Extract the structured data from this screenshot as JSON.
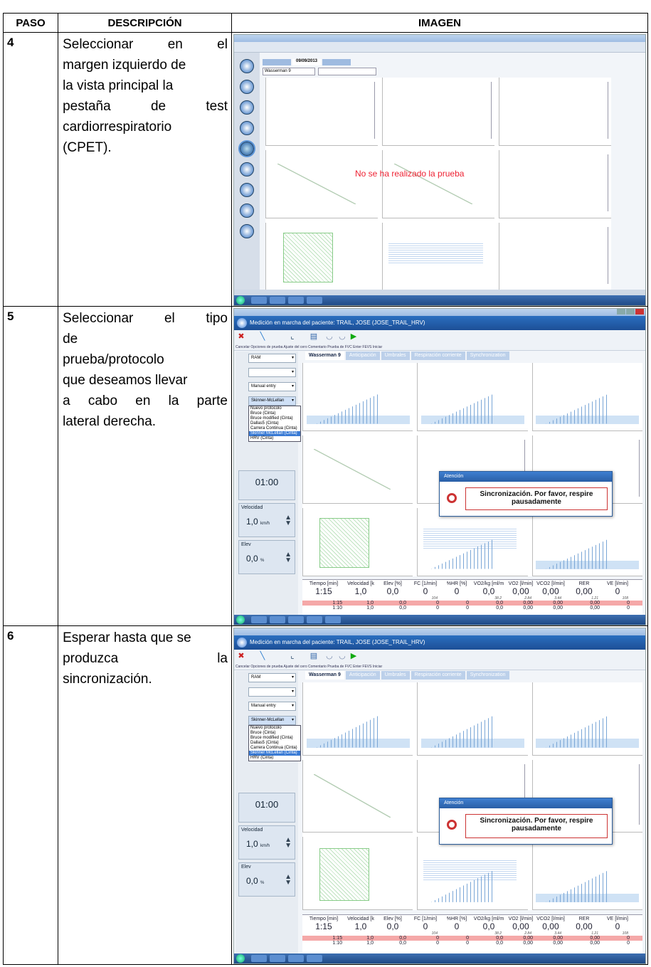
{
  "table": {
    "headers": [
      "PASO",
      "DESCRIPCIÓN",
      "IMAGEN"
    ],
    "rows": [
      {
        "paso": "4",
        "lines": [
          "Seleccionar en el",
          "margen izquierdo de",
          "la vista principal la",
          "pestaña de test",
          "cardiorrespiratorio",
          "(CPET)."
        ]
      },
      {
        "paso": "5",
        "lines": [
          "Seleccionar el tipo",
          "de",
          "prueba/protocolo",
          "que deseamos llevar",
          "a cabo en la parte",
          "lateral derecha."
        ]
      },
      {
        "paso": "6",
        "lines": [
          "Esperar hasta que se",
          "produzca la",
          "sincronización."
        ]
      }
    ]
  },
  "shot4": {
    "combo": "Wasserman 9",
    "date": "09/09/2013",
    "nodata": "No se ha realizado la prueba"
  },
  "shot": {
    "app_title": "Medición en marcha del paciente: TRAIL, JOSE (JOSE_TRAIL_HRV)",
    "toolbar": "Cancelar  Opciones de prueba  Ajuste del cero  Comentario  Prueba de FVC  Enter FEVS  Iniciar",
    "tabs": [
      "Wasserman 9",
      "Anticipación",
      "Umbrales",
      "Respiración corriente",
      "Synchronization"
    ],
    "sel_ram": "RAM",
    "sel_manual": "Manual entry",
    "sel_protocol": "Skinner-McLellan",
    "dropdown": [
      "Nuevo protocolo",
      "Bruce (Cinta)",
      "Bruce modified (Cinta)",
      "Dallas5 (Cinta)",
      "Carrera Continua (Cinta)",
      "Skinner McLellan (Cinta)",
      "HRV (Cinta)"
    ],
    "timer": "01:00",
    "velocidad_label": "Velocidad",
    "velocidad_value": "1,0",
    "velocidad_unit": "km/h",
    "elev_label": "Elev",
    "elev_value": "0,0",
    "elev_unit": "%",
    "dialog_title": "Atención",
    "dialog_msg": "Sincronización. Por favor, respire pausadamente",
    "cols": [
      "Tiempo [min]",
      "Velocidad [k",
      "Elev [%]",
      "FC [1/min]",
      "%HR [%]",
      "VO2/kg [ml/m",
      "VO2 [l/min]",
      "VCO2 [l/min]",
      "RER",
      "VE [l/min]"
    ],
    "vals": [
      "1:15",
      "1,0",
      "0,0",
      "0",
      "0",
      "0,0",
      "0,00",
      "0,00",
      "0,00",
      "0"
    ],
    "subs": [
      "",
      "",
      "",
      "104",
      "",
      "38.2",
      "2.84",
      "3.44",
      "1.21",
      "108"
    ],
    "red": [
      "1:15",
      "1,0",
      "0,0",
      "0",
      "0",
      "0,0",
      "0,00",
      "0,00",
      "0,00",
      "0"
    ],
    "last": [
      "1:10",
      "1,0",
      "0,0",
      "0",
      "0",
      "0,0",
      "0,00",
      "0,00",
      "0,00",
      "0"
    ]
  }
}
